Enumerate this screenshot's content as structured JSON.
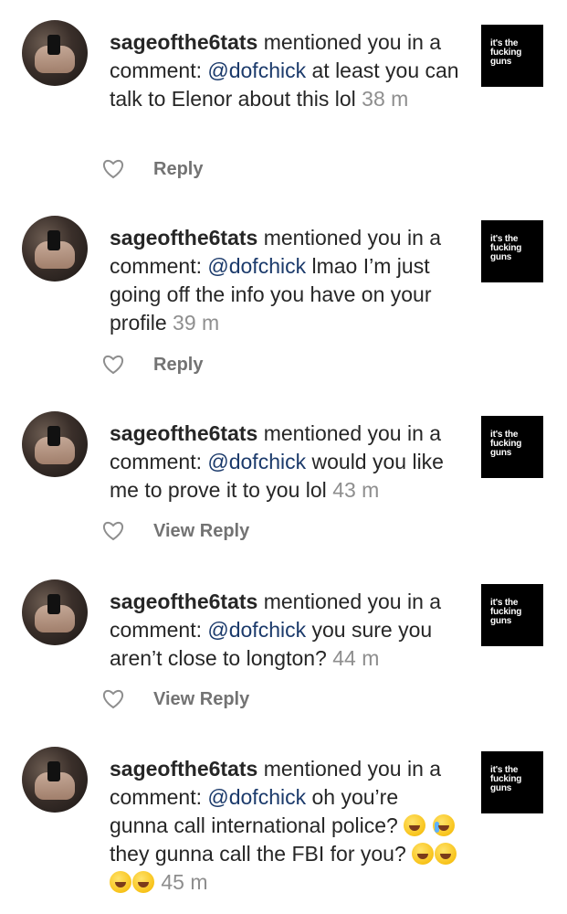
{
  "notifications": [
    {
      "username": "sageofthe6tats",
      "action": " mentioned you in a comment: ",
      "mention": "@dofchick",
      "comment": " at least you can talk to Elenor about this lol ",
      "emojis": [],
      "time": "38 m",
      "reply_label": "Reply",
      "thumb_lines": [
        "it's the",
        "fucking",
        "guns"
      ]
    },
    {
      "username": "sageofthe6tats",
      "action": " mentioned you in a comment: ",
      "mention": "@dofchick",
      "comment": " lmao I’m just going off the info you have on your profile ",
      "emojis": [],
      "time": "39 m",
      "reply_label": "Reply",
      "thumb_lines": [
        "it's the",
        "fucking",
        "guns"
      ]
    },
    {
      "username": "sageofthe6tats",
      "action": " mentioned you in a comment: ",
      "mention": "@dofchick",
      "comment": " would you like me to prove it to you lol ",
      "emojis": [],
      "time": "43 m",
      "reply_label": "View Reply",
      "thumb_lines": [
        "it's the",
        "fucking",
        "guns"
      ]
    },
    {
      "username": "sageofthe6tats",
      "action": " mentioned you in a comment: ",
      "mention": "@dofchick",
      "comment": " you sure you aren’t close to longton? ",
      "emojis": [],
      "time": "44 m",
      "reply_label": "View Reply",
      "thumb_lines": [
        "it's the",
        "fucking",
        "guns"
      ]
    },
    {
      "username": "sageofthe6tats",
      "action": " mentioned you in a comment: ",
      "mention": "@dofchick",
      "comment": " oh you’re gunna call international police? ",
      "comment_extra": " they gunna call the FBI for you? ",
      "emojis": [
        "rolling-on-floor-laughing",
        "loudly-crying",
        "rolling-on-floor-laughing",
        "rolling-on-floor-laughing",
        "rolling-on-floor-laughing",
        "rolling-on-floor-laughing"
      ],
      "time": "45 m",
      "reply_label": "",
      "thumb_lines": [
        "it's the",
        "fucking",
        "guns"
      ]
    }
  ],
  "colors": {
    "mention": "#1b3a6b",
    "timestamp": "#8e8e8e",
    "reply": "#737373"
  }
}
